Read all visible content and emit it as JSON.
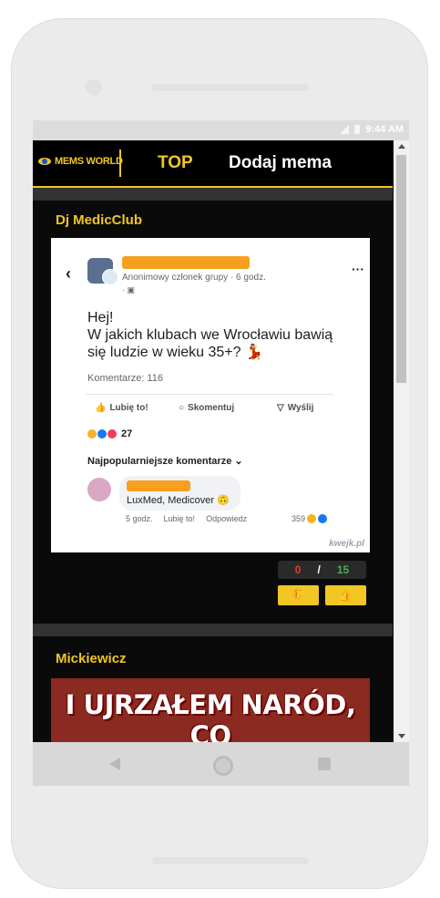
{
  "status": {
    "time": "9:44 AM"
  },
  "header": {
    "logo_text": "MEMS WORLD",
    "nav": [
      {
        "label": "TOP"
      },
      {
        "label": "Dodaj mema"
      }
    ]
  },
  "posts": [
    {
      "title": "Dj MedicClub",
      "meme": {
        "author_line": "Anonimowy członek grupy · 6 godz.",
        "audience_line": "· ",
        "text": "Hej!\nW jakich klubach we Wrocławiu bawią się ludzie w wieku 35+? 💃",
        "comments_count": "Komentarze: 116",
        "actions": [
          {
            "label": "Lubię to!",
            "icon": "like-icon"
          },
          {
            "label": "Skomentuj",
            "icon": "comment-icon"
          },
          {
            "label": "Wyślij",
            "icon": "send-icon"
          }
        ],
        "reactions_count": "27",
        "popular_label": "Najpopularniejsze komentarze",
        "comment_text": "LuxMed, Medicover 🙃",
        "comment_meta": [
          "5 godz.",
          "Lubię to!",
          "Odpowiedz"
        ],
        "comment_reactions": "359",
        "watermark": "kwejk.pl"
      },
      "score": {
        "down": "0",
        "separator": "/",
        "up": "15"
      }
    },
    {
      "title": "Mickiewicz",
      "meme_text": "I UJRZAŁEM NARÓD, CO\nBEZ CELU SIĘ BŁĄKA"
    }
  ],
  "colors": {
    "accent": "#f2c624",
    "background": "#0a0a0a",
    "down": "#e53935",
    "up": "#4caf50"
  }
}
